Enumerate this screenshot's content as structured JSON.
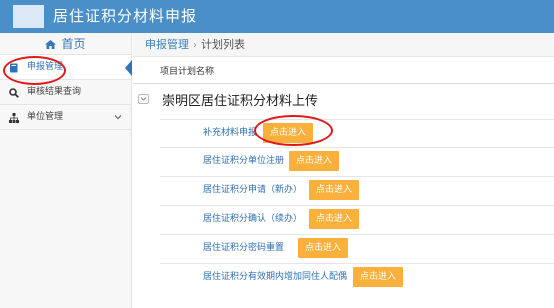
{
  "header": {
    "title": "居住证积分材料申报"
  },
  "sidebar": {
    "home_label": "首页",
    "items": [
      {
        "label": "申报管理",
        "icon": "book-icon",
        "active": true
      },
      {
        "label": "审核结果查询",
        "icon": "search-icon"
      },
      {
        "label": "单位管理",
        "icon": "org-chart-icon",
        "expandable": true
      }
    ]
  },
  "breadcrumb": {
    "parent": "申报管理",
    "separator": "›",
    "current": "计划列表"
  },
  "table": {
    "column_header": "项目计划名称",
    "group_title": "崇明区居住证积分材料上传",
    "rows": [
      {
        "label": "补充材料申报",
        "button": "点击进入"
      },
      {
        "label": "居住证积分单位注册",
        "button": "点击进入"
      },
      {
        "label": "居住证积分申请（新办）",
        "button": "点击进入"
      },
      {
        "label": "居住证积分确认（续办）",
        "button": "点击进入"
      },
      {
        "label": "居住证积分密码重置",
        "button": "点击进入"
      },
      {
        "label": "居住证积分有效期内增加同住人配偶",
        "button": "点击进入"
      }
    ]
  },
  "colors": {
    "header_bg": "#4a8fc8",
    "accent": "#2e73b8",
    "button": "#fbb03b",
    "annotation": "#e01818"
  }
}
